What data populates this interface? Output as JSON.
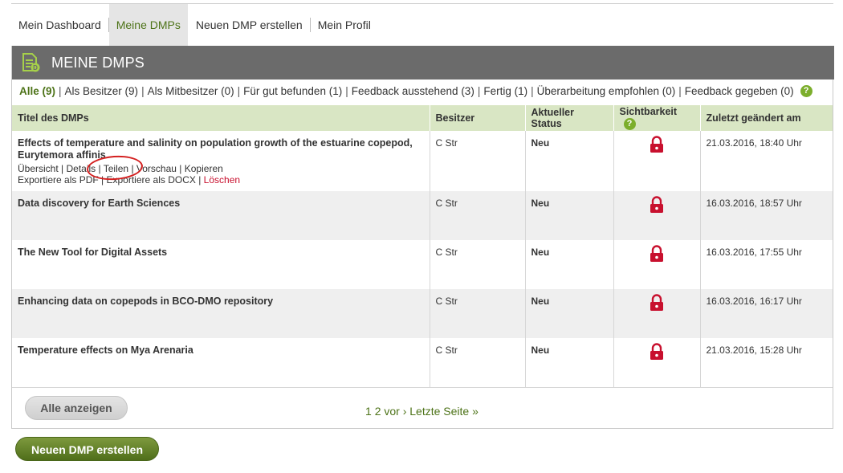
{
  "tabs": [
    {
      "label": "Mein Dashboard",
      "active": false
    },
    {
      "label": "Meine DMPs",
      "active": true
    },
    {
      "label": "Neuen DMP erstellen",
      "active": false
    },
    {
      "label": "Mein Profil",
      "active": false
    }
  ],
  "panel": {
    "title": "MEINE DMPS"
  },
  "filters": [
    "Alle (9)",
    "Als Besitzer (9)",
    "Als Mitbesitzer (0)",
    "Für gut befunden (1)",
    "Feedback ausstehend (3)",
    "Fertig (1)",
    "Überarbeitung empfohlen (0)",
    "Feedback gegeben (0)"
  ],
  "help_mark": "?",
  "table": {
    "headers": {
      "title": "Titel des DMPs",
      "owner": "Besitzer",
      "status": "Aktueller Status",
      "visibility": "Sichtbarkeit",
      "updated": "Zuletzt geändert am"
    },
    "rows": [
      {
        "title": "Effects of temperature and salinity on population growth of the estuarine copepod, Eurytemora affinis",
        "owner": "C Str",
        "status": "Neu",
        "visibility": "lock-icon",
        "updated": "21.03.2016, 18:40 Uhr"
      },
      {
        "title": "Data discovery for Earth Sciences",
        "owner": "C Str",
        "status": "Neu",
        "visibility": "lock-icon",
        "updated": "16.03.2016, 18:57 Uhr"
      },
      {
        "title": "The New Tool for Digital Assets",
        "owner": "C Str",
        "status": "Neu",
        "visibility": "lock-icon",
        "updated": "16.03.2016, 17:55 Uhr"
      },
      {
        "title": "Enhancing data on copepods in BCO-DMO repository",
        "owner": "C Str",
        "status": "Neu",
        "visibility": "lock-icon",
        "updated": "16.03.2016, 16:17 Uhr"
      },
      {
        "title": "Temperature effects on Mya Arenaria",
        "owner": "C Str",
        "status": "Neu",
        "visibility": "lock-icon",
        "updated": "21.03.2016, 15:28 Uhr"
      }
    ],
    "actions": {
      "overview": "Übersicht",
      "details": "Details",
      "share": "Teilen",
      "preview": "Vorschau",
      "copy": "Kopieren",
      "export_pdf": "Exportiere als PDF",
      "export_docx": "Exportiere als DOCX",
      "delete": "Löschen"
    }
  },
  "footer": {
    "show_all": "Alle anzeigen",
    "pager": {
      "page1": "1",
      "page2": "2",
      "next": "vor ›",
      "last": "Letzte Seite »"
    }
  },
  "new_dmp_button": "Neuen DMP erstellen",
  "colors": {
    "accent_green": "#4d7318",
    "header_gray": "#6b6b6b",
    "table_header": "#d9e6c4",
    "lock_red": "#c8102e"
  }
}
